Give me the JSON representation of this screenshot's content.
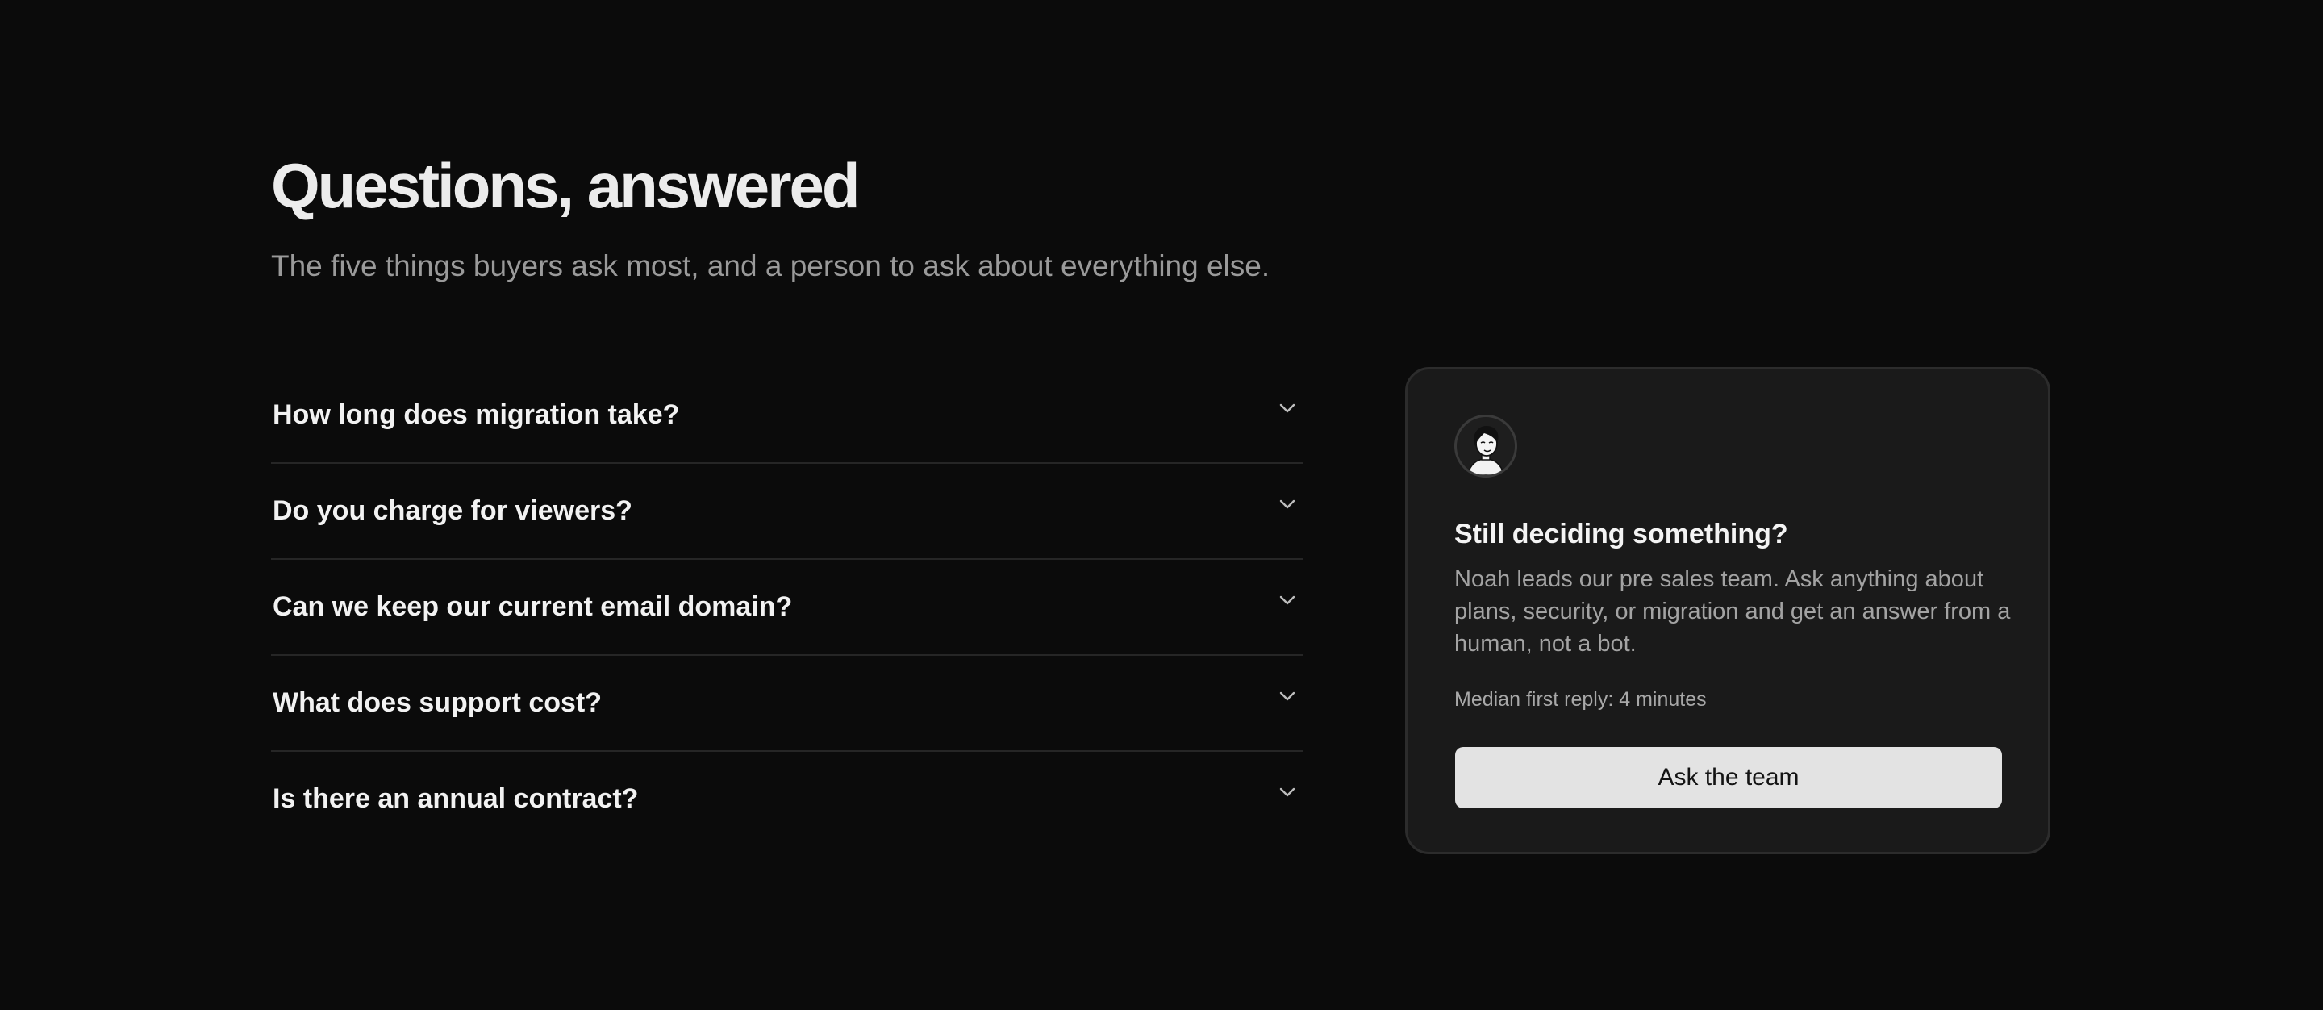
{
  "header": {
    "title": "Questions, answered",
    "subtitle": "The five things buyers ask most, and a person to ask about everything else."
  },
  "faq": {
    "items": [
      {
        "question": "How long does migration take?",
        "icon": "chevron-down-icon"
      },
      {
        "question": "Do you charge for viewers?",
        "icon": "chevron-down-icon"
      },
      {
        "question": "Can we keep our current email domain?",
        "icon": "chevron-down-icon"
      },
      {
        "question": "What does support cost?",
        "icon": "chevron-down-icon"
      },
      {
        "question": "Is there an annual contract?",
        "icon": "chevron-down-icon"
      }
    ]
  },
  "contact_card": {
    "avatar_icon": "person-avatar-icon",
    "title": "Still deciding something?",
    "body": "Noah leads our pre sales team. Ask anything about plans, security, or migration and get an answer from a human, not a bot.",
    "meta": "Median first reply: 4 minutes",
    "button_label": "Ask the team"
  },
  "colors": {
    "background": "#0b0b0b",
    "card_background": "#1a1a1a",
    "button_background": "#e3e3e3",
    "divider": "#262626"
  }
}
